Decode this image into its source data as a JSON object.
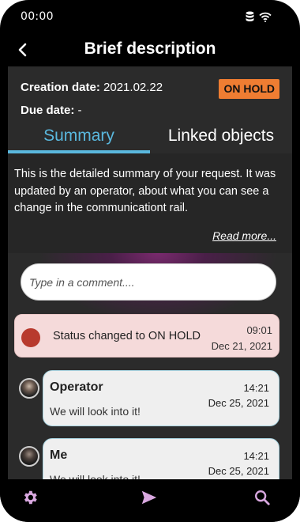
{
  "status_bar": {
    "time": "00:00"
  },
  "header": {
    "title": "Brief description"
  },
  "info": {
    "creation_label": "Creation date:",
    "creation_value": "2021.02.22",
    "due_label": "Due date:",
    "due_value": "-",
    "status_badge": "ON HOLD"
  },
  "tabs": [
    {
      "label": "Summary",
      "active": true
    },
    {
      "label": "Linked objects",
      "active": false
    }
  ],
  "summary": {
    "text": "This is the detailed summary of your request. It was updated by an operator, about what you can see a change in the communicationt rail.",
    "read_more": "Read more..."
  },
  "comment": {
    "placeholder": "Type in a comment...."
  },
  "status_event": {
    "text": "Status changed to ON HOLD",
    "time": "09:01",
    "date": "Dec 21, 2021"
  },
  "messages": [
    {
      "sender": "Operator",
      "time": "14:21",
      "date": "Dec 25, 2021",
      "text": "We will look into it!"
    },
    {
      "sender": "Me",
      "time": "14:21",
      "date": "Dec 25, 2021",
      "text": "We will look into it!"
    }
  ],
  "colors": {
    "accent": "#5ab8de",
    "badge": "#ef7d32",
    "status_dot": "#b83a2e"
  },
  "icons": [
    "database-icon",
    "wifi-icon",
    "back-arrow-icon",
    "gear-icon",
    "send-icon",
    "search-icon"
  ]
}
